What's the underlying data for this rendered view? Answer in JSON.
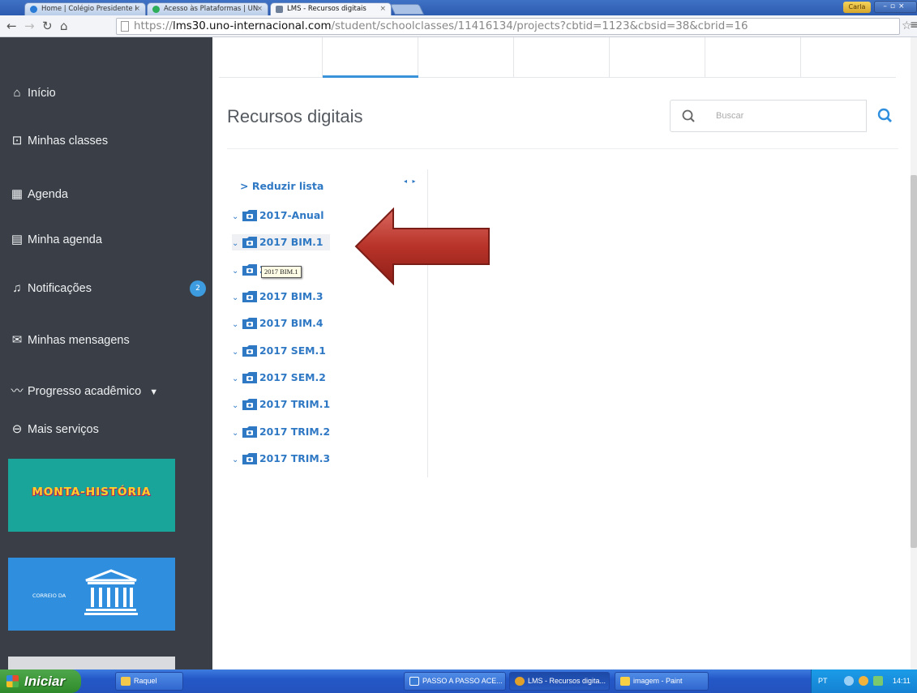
{
  "browser": {
    "tabs": [
      {
        "title": "Home | Colégio Presidente I"
      },
      {
        "title": "Acesso às Plataformas | UN"
      },
      {
        "title": "LMS - Recursos digitais"
      }
    ],
    "user_label": "Carla",
    "url_scheme": "https://",
    "url_host": "lms30.uno-internacional.com",
    "url_path": "/student/schoolclasses/11416134/projects?cbtid=1123&cbsid=38&cbrid=16"
  },
  "sidebar": {
    "items": [
      {
        "label": "Início",
        "icon": "home-icon"
      },
      {
        "label": "Minhas classes",
        "icon": "screen-icon"
      },
      {
        "label": "Agenda",
        "icon": "calendar-icon"
      },
      {
        "label": "Minha agenda",
        "icon": "calendar-grid-icon"
      },
      {
        "label": "Notificações",
        "icon": "bell-icon"
      },
      {
        "label": "Minhas mensagens",
        "icon": "envelope-icon"
      },
      {
        "label": "Progresso acadêmico",
        "icon": "chart-line-icon"
      },
      {
        "label": "Mais serviços",
        "icon": "circle-minus-icon"
      }
    ],
    "notification_badge": "2",
    "promo1_text": "MONTA-HISTÓRIA",
    "promo2_text": "CORREIO DA"
  },
  "main": {
    "title": "Recursos digitais",
    "search_placeholder": "Buscar",
    "reduce_label": "> Reduzir lista",
    "tree": [
      {
        "label": "2017-Anual"
      },
      {
        "label": "2017 BIM.1"
      },
      {
        "label": "20"
      },
      {
        "label": "2017 BIM.3"
      },
      {
        "label": "2017 BIM.4"
      },
      {
        "label": "2017 SEM.1"
      },
      {
        "label": "2017 SEM.2"
      },
      {
        "label": "2017 TRIM.1"
      },
      {
        "label": "2017 TRIM.2"
      },
      {
        "label": "2017 TRIM.3"
      }
    ],
    "tooltip": "2017 BIM.1"
  },
  "taskbar": {
    "start_label": "Iniciar",
    "tasks": [
      {
        "label": "Raquel"
      },
      {
        "label": "PASSO A PASSO ACE..."
      },
      {
        "label": "LMS - Recursos digita..."
      },
      {
        "label": "imagem - Paint"
      }
    ],
    "lang": "PT",
    "clock": "14:11"
  },
  "colors": {
    "sidebar_bg": "#3a3f47",
    "accent_blue": "#2f78c4",
    "arrow_red": "#b32a22"
  }
}
